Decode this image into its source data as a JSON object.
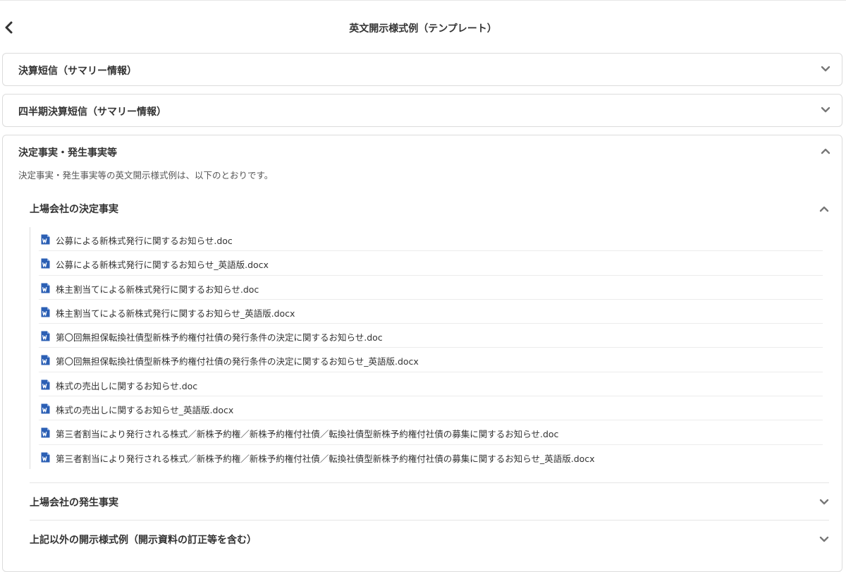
{
  "header": {
    "title": "英文開示様式例（テンプレート）"
  },
  "sections": [
    {
      "title": "決算短信（サマリー情報）",
      "expanded": false
    },
    {
      "title": "四半期決算短信（サマリー情報）",
      "expanded": false
    },
    {
      "title": "決定事実・発生事実等",
      "expanded": true,
      "description": "決定事実・発生事実等の英文開示様式例は、以下のとおりです。",
      "subsections": [
        {
          "title": "上場会社の決定事実",
          "expanded": true,
          "files": [
            "公募による新株式発行に関するお知らせ.doc",
            "公募による新株式発行に関するお知らせ_英語版.docx",
            "株主割当てによる新株式発行に関するお知らせ.doc",
            "株主割当てによる新株式発行に関するお知らせ_英語版.docx",
            "第〇回無担保転換社債型新株予約権付社債の発行条件の決定に関するお知らせ.doc",
            "第〇回無担保転換社債型新株予約権付社債の発行条件の決定に関するお知らせ_英語版.docx",
            "株式の売出しに関するお知らせ.doc",
            "株式の売出しに関するお知らせ_英語版.docx",
            "第三者割当により発行される株式／新株予約権／新株予約権付社債／転換社債型新株予約権付社債の募集に関するお知らせ.doc",
            "第三者割当により発行される株式／新株予約権／新株予約権付社債／転換社債型新株予約権付社債の募集に関するお知らせ_英語版.docx"
          ]
        },
        {
          "title": "上場会社の発生事実",
          "expanded": false
        },
        {
          "title": "上記以外の開示様式例（開示資料の訂正等を含む）",
          "expanded": false
        }
      ]
    }
  ],
  "icons": {
    "back": "chevron-left-icon",
    "expand": "chevron-down-icon",
    "collapse": "chevron-up-icon",
    "file": "word-document-icon"
  },
  "colors": {
    "word_icon": "#2b5fb4",
    "border": "#dcdcdc",
    "text": "#333333"
  }
}
